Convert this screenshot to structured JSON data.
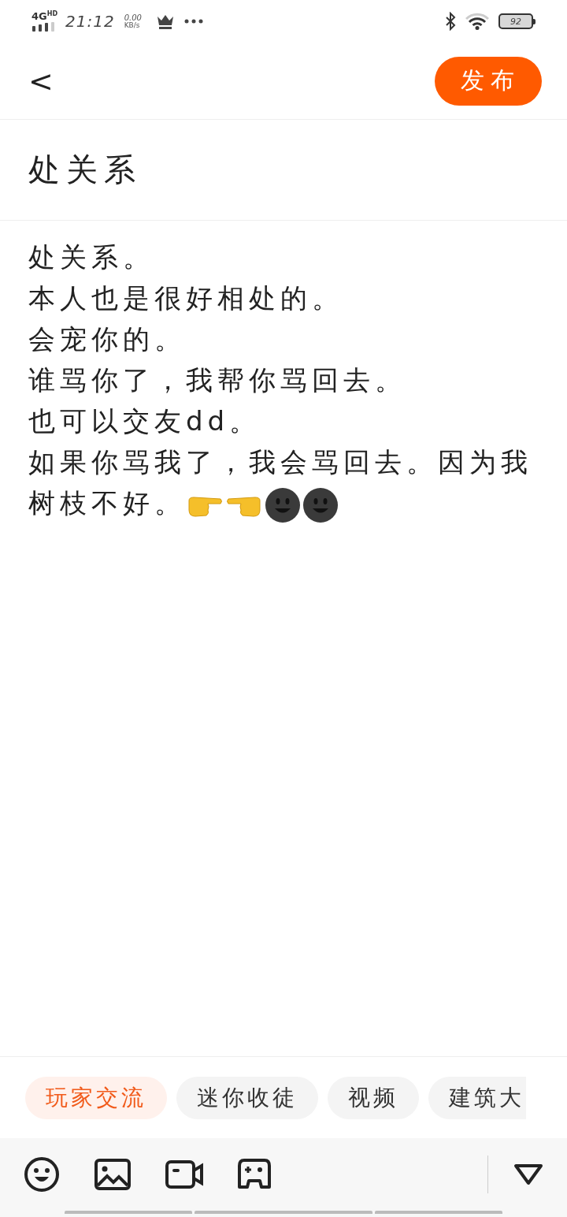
{
  "status_bar": {
    "network": "4G",
    "network_extra": "HD",
    "time": "21:12",
    "speed_value": "0.00",
    "speed_unit": "KB/s",
    "battery": "92"
  },
  "header": {
    "back": "<",
    "publish_button": "发布"
  },
  "post": {
    "title": "处关系",
    "body_lines": [
      "处关系。",
      "本人也是很好相处的。",
      "会宠你的。",
      "谁骂你了，我帮你骂回去。",
      "也可以交友dd。",
      "如果你骂我了，我会骂回去。因为我树枝不好。"
    ]
  },
  "tags": [
    {
      "label": "玩家交流",
      "selected": true
    },
    {
      "label": "迷你收徒",
      "selected": false
    },
    {
      "label": "视频",
      "selected": false
    },
    {
      "label": "建筑大",
      "selected": false
    }
  ]
}
